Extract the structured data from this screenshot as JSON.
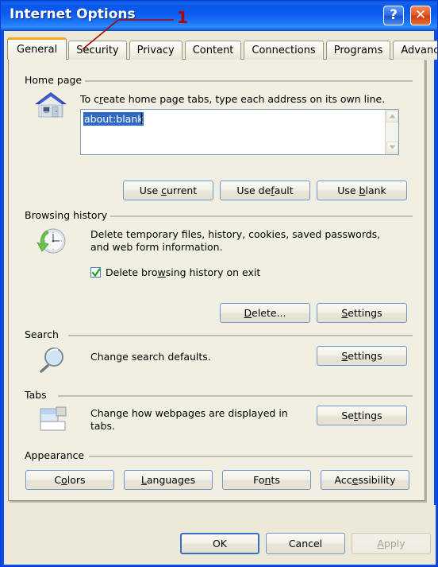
{
  "window": {
    "title": "Internet Options",
    "help_button": "?",
    "close_button": "✕",
    "frame_color": "#0C4FE8",
    "title_gradient_start": "#0A4FE0",
    "dialog_background": "#ECE9D8",
    "panel_background": "#F1EFE2"
  },
  "annotation": {
    "number": "1",
    "color": "#B00000",
    "points_to": "Security tab"
  },
  "tabs": [
    {
      "label": "General",
      "active": true
    },
    {
      "label": "Security",
      "active": false
    },
    {
      "label": "Privacy",
      "active": false
    },
    {
      "label": "Content",
      "active": false
    },
    {
      "label": "Connections",
      "active": false
    },
    {
      "label": "Programs",
      "active": false
    },
    {
      "label": "Advanced",
      "active": false
    }
  ],
  "active_tab_accent": "#F5A623",
  "groups": {
    "home_page": {
      "label": "Home page",
      "icon": "house-icon",
      "description": "To create home page tabs, type each address on its own line.",
      "description_accel": "r",
      "textarea": {
        "value": "about:blank",
        "selected": true,
        "selection_color": "#316AC5",
        "scrollbar": "disabled"
      },
      "buttons": [
        {
          "label_pre": "Use ",
          "accel": "c",
          "label_post": "urrent",
          "full": "Use current"
        },
        {
          "label_pre": "Use de",
          "accel": "f",
          "label_post": "ault",
          "full": "Use default"
        },
        {
          "label_pre": "Use ",
          "accel": "b",
          "label_post": "lank",
          "full": "Use blank"
        }
      ]
    },
    "browsing_history": {
      "label": "Browsing history",
      "icon": "clock-history-icon",
      "description_line1": "Delete temporary files, history, cookies, saved passwords,",
      "description_line2": "and web form information.",
      "checkbox": {
        "label_pre": "Delete bro",
        "accel": "w",
        "label_post": "sing history on exit",
        "full": "Delete browsing history on exit",
        "checked": true,
        "check_color": "#1E9A1E"
      },
      "buttons": [
        {
          "label_pre": "",
          "accel": "D",
          "label_post": "elete...",
          "full": "Delete..."
        },
        {
          "label_pre": "",
          "accel": "S",
          "label_post": "ettings",
          "full": "Settings"
        }
      ]
    },
    "search": {
      "label": "Search",
      "icon": "magnifier-icon",
      "description": "Change search defaults.",
      "button": {
        "label_pre": "",
        "accel": "S",
        "label_post": "ettings",
        "full": "Settings"
      }
    },
    "tabs_section": {
      "label": "Tabs",
      "icon": "browser-tabs-icon",
      "description_line1": "Change how webpages are displayed in",
      "description_line2": "tabs.",
      "button": {
        "label_pre": "Se",
        "accel": "t",
        "label_post": "tings",
        "full": "Settings"
      }
    },
    "appearance": {
      "label": "Appearance",
      "buttons": [
        {
          "label_pre": "C",
          "accel": "o",
          "label_post": "lors",
          "full": "Colors"
        },
        {
          "label_pre": "",
          "accel": "L",
          "label_post": "anguages",
          "full": "Languages"
        },
        {
          "label_pre": "Fo",
          "accel": "n",
          "label_post": "ts",
          "full": "Fonts"
        },
        {
          "label_pre": "Acc",
          "accel": "e",
          "label_post": "ssibility",
          "full": "Accessibility"
        }
      ]
    }
  },
  "footer": {
    "ok": {
      "label": "OK",
      "default": true,
      "enabled": true
    },
    "cancel": {
      "label": "Cancel",
      "default": false,
      "enabled": true
    },
    "apply": {
      "label_pre": "",
      "accel": "A",
      "label_post": "pply",
      "full": "Apply",
      "enabled": false
    }
  }
}
